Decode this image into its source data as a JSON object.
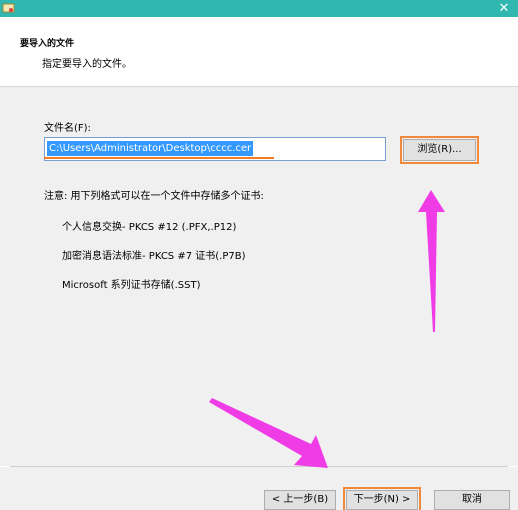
{
  "window": {
    "close_glyph": "✕"
  },
  "header": {
    "title": "要导入的文件",
    "subtitle": "指定要导入的文件。"
  },
  "form": {
    "filename_label": "文件名(F):",
    "filename_value": "C:\\Users\\Administrator\\Desktop\\cccc.cer",
    "browse_label": "浏览(R)..."
  },
  "notes": {
    "intro": "注意: 用下列格式可以在一个文件中存储多个证书:",
    "formats": [
      "个人信息交换- PKCS #12 (.PFX,.P12)",
      "加密消息语法标准- PKCS #7 证书(.P7B)",
      "Microsoft 系列证书存储(.SST)"
    ]
  },
  "footer": {
    "back_label": "< 上一步(B)",
    "next_label": "下一步(N) >",
    "cancel_label": "取消"
  },
  "colors": {
    "titlebar": "#2fb7b0",
    "highlight_box": "#f08a3a",
    "arrow": "#f03ce6",
    "selection": "#3399ff"
  },
  "icons": {
    "app": "certificate-icon",
    "close": "close-icon"
  }
}
